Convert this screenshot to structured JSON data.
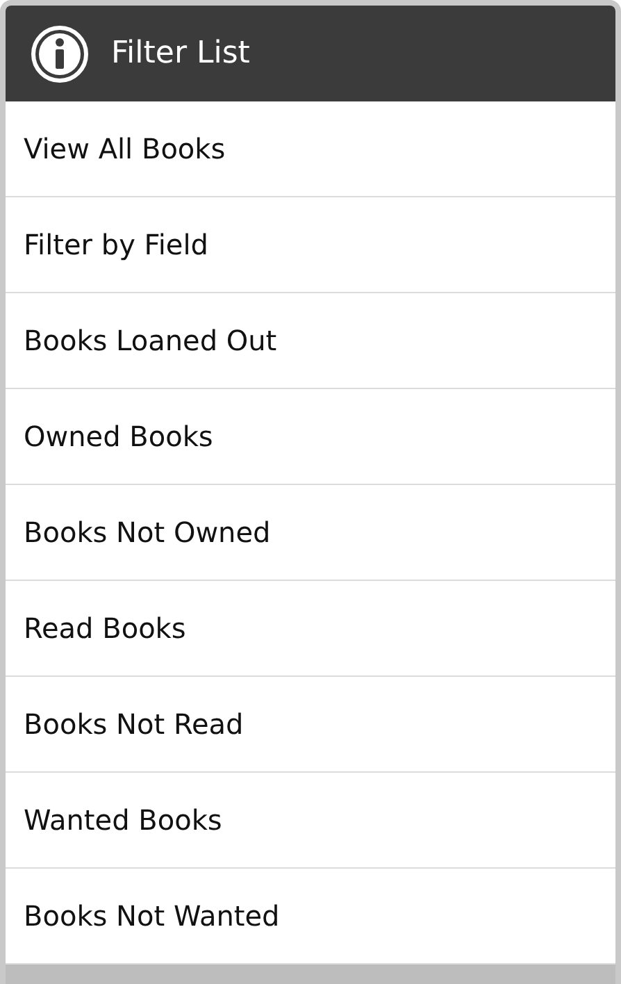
{
  "dialog": {
    "title": "Filter List"
  },
  "items": [
    {
      "label": "View All Books"
    },
    {
      "label": "Filter by Field"
    },
    {
      "label": "Books Loaned Out"
    },
    {
      "label": "Owned Books"
    },
    {
      "label": "Books Not Owned"
    },
    {
      "label": "Read Books"
    },
    {
      "label": "Books Not Read"
    },
    {
      "label": "Wanted Books"
    },
    {
      "label": "Books Not Wanted"
    }
  ]
}
